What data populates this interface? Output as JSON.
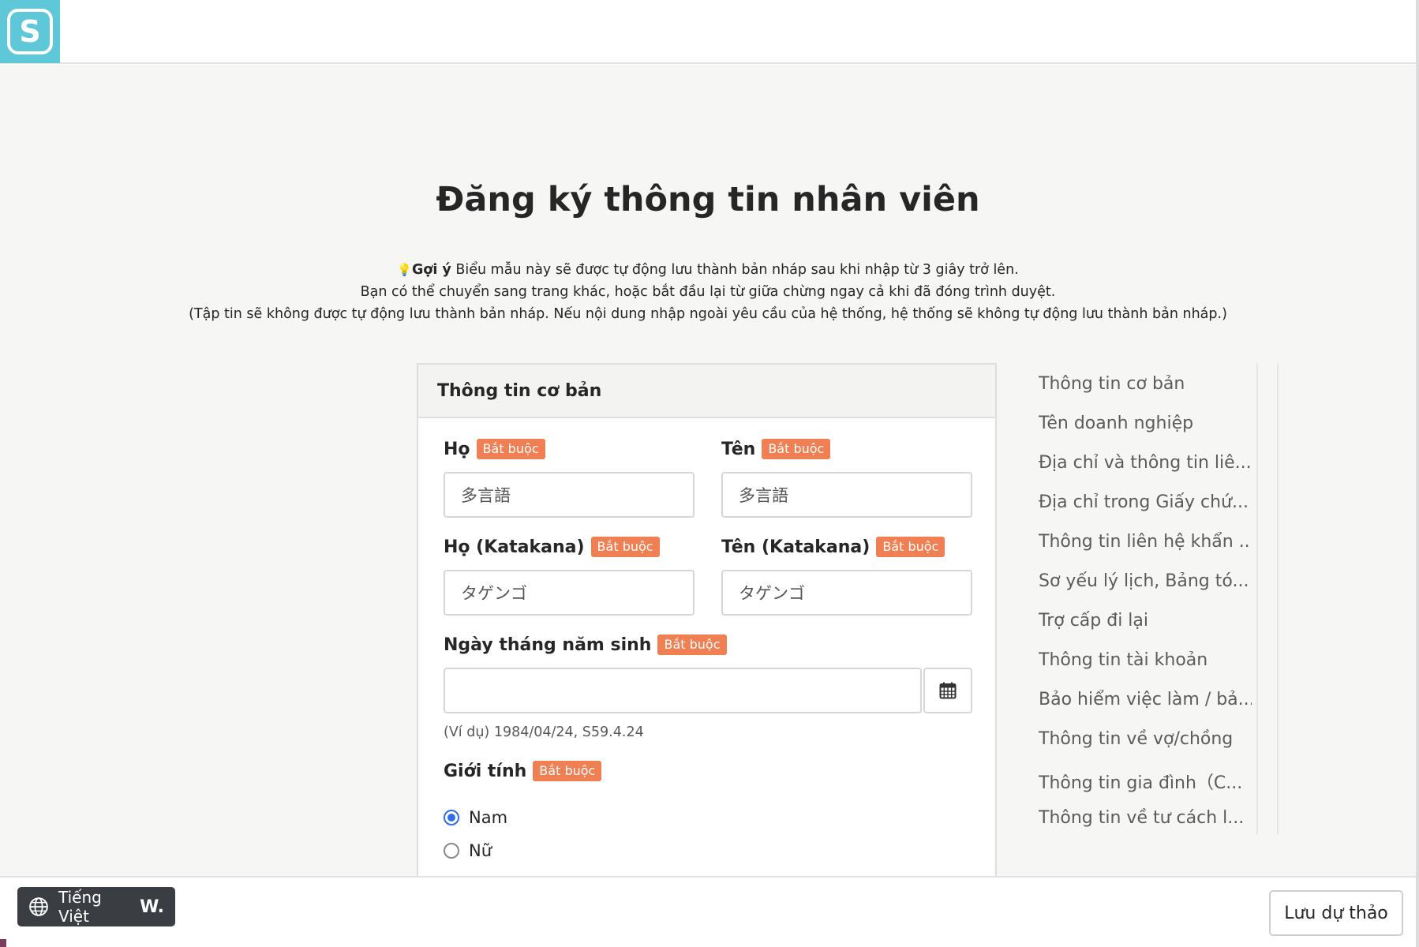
{
  "app": {
    "logo_letter": "S",
    "accent_color": "#5ec8d8"
  },
  "page": {
    "title": "Đăng ký thông tin nhân viên",
    "hint_icon": "💡",
    "hint_label": "Gợi ý",
    "hint_line1": " Biểu mẫu này sẽ được tự động lưu thành bản nháp sau khi nhập từ 3 giây trở lên.",
    "hint_line2": "Bạn có thể chuyển sang trang khác, hoặc bắt đầu lại từ giữa chừng ngay cả khi đã đóng trình duyệt.",
    "hint_line3": "(Tập tin sẽ không được tự động lưu thành bản nháp. Nếu nội dung nhập ngoài yêu cầu của hệ thống, hệ thống sẽ không tự động lưu thành bản nháp.)"
  },
  "form": {
    "section_title": "Thông tin cơ bản",
    "required_badge": "Bắt buộc",
    "last_name_label": "Họ",
    "last_name_value": "多言語",
    "first_name_label": "Tên",
    "first_name_value": "多言語",
    "last_name_kana_label": "Họ (Katakana)",
    "last_name_kana_value": "タゲンゴ",
    "first_name_kana_label": "Tên (Katakana)",
    "first_name_kana_value": "タゲンゴ",
    "birthdate_label": "Ngày tháng năm sinh",
    "birthdate_value": "",
    "birthdate_example": "(Ví dụ) 1984/04/24, S59.4.24",
    "gender_label": "Giới tính",
    "gender_options": [
      "Nam",
      "Nữ"
    ],
    "gender_selected": "Nam"
  },
  "sidenav": {
    "items": [
      "Thông tin cơ bản",
      "Tên doanh nghiệp",
      "Địa chỉ và thông tin liê...",
      "Địa chỉ trong Giấy chứ...",
      "Thông tin liên hệ khẩn ...",
      "Sơ yếu lý lịch, Bảng tó...",
      "Trợ cấp đi lại",
      "Thông tin tài khoản",
      "Bảo hiểm việc làm / bả...",
      "Thông tin về vợ/chồng",
      "Thông tin gia đình（C...",
      "Thông tin về tư cách l..."
    ]
  },
  "footer": {
    "language_label": "Tiếng Việt",
    "language_mark": "W.",
    "save_draft_label": "Lưu dự thảo"
  }
}
